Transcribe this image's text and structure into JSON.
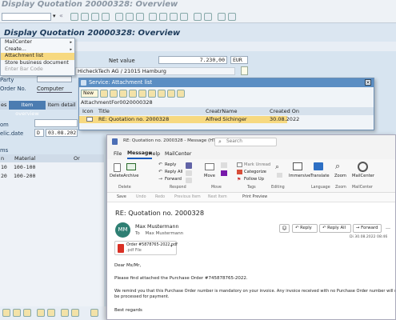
{
  "sap": {
    "title_bar": "Display Quotation 20000328: Overview",
    "screen_title": "Display Quotation 20000328: Overview",
    "menu": [
      "MailCenter",
      "Create...",
      "Attachment list",
      "Store business document",
      "Enter Bar Code"
    ],
    "net_value_label": "Net value",
    "net_value": "7.230,00",
    "currency": "EUR",
    "partner": "HicheckTech AG / 21015 Hamburg",
    "left_labels": {
      "party": "Party",
      "order_no": "Order No.",
      "computer": "Computer",
      "tab_overview": "Item overview",
      "tab_detail": "Item detail",
      "tab_sales": "es",
      "from": "om",
      "deliv_date": "elic.date",
      "items": "ms"
    },
    "deliv_date_type": "D",
    "deliv_date_value": "03.08.202",
    "item_table_headers": [
      "n",
      "Material",
      "Or"
    ],
    "item_rows": [
      {
        "num": "10",
        "material": "100-100"
      },
      {
        "num": "20",
        "material": "100-200"
      }
    ]
  },
  "attachment": {
    "title": "Service: Attachment list",
    "new_label": "New",
    "subtitle": "AttachmentFor0020000328",
    "headers": [
      "Icon",
      "Title",
      "CreatrName",
      "Created On"
    ],
    "row": {
      "title": "RE: Quotation no. 2000328",
      "creator": "Alfred Sichinger",
      "date": "30.08.2022"
    }
  },
  "outlook": {
    "title": "RE: Quotation no. 2000328 - Message (HTML)",
    "search_placeholder": "Search",
    "tabs": [
      "File",
      "Message",
      "Help",
      "MailCenter"
    ],
    "ribbon": {
      "delete": "Delete",
      "archive": "Archive",
      "delete_group": "Delete",
      "reply": "Reply",
      "reply_all": "Reply All",
      "forward": "Forward",
      "respond_group": "Respond",
      "move": "Move",
      "move_group": "Move",
      "mark_unread": "Mark Unread",
      "categorize": "Categorize",
      "follow_up": "Follow Up",
      "tags_group": "Tags",
      "editing_group": "Editing",
      "immersive": "Immersive",
      "translate": "Translate",
      "language_group": "Language",
      "zoom": "Zoom",
      "zoom_group": "Zoom",
      "mailcenter": "MailCenter",
      "mailcenter_group": "MailCenter"
    },
    "qat": [
      "Save",
      "Undo",
      "Redo",
      "Previous Item",
      "Next Item",
      "Print Preview"
    ],
    "subject": "RE: Quotation no. 2000328",
    "avatar_initials": "MM",
    "sender": "Max Mustermann",
    "to_label": "To",
    "to": "Max Mustermann",
    "actions": {
      "reply": "Reply",
      "reply_all": "Reply All",
      "forward": "Forward"
    },
    "date": "Di 30.08.2022 08:46",
    "attachment_name": "Order #5878765-2022.pdf",
    "attachment_type": ".pdf File",
    "body": {
      "greeting": "Dear Ms/Mr,",
      "p1": "Please find attached the Purchase Order #745878765-2022.",
      "p2a": "We remind you that this Purchase Order number is mandatory on your invoice. Any invoice received with no Purchase Order number will not",
      "p2b": "be processed for payment.",
      "closing": "Best regards"
    }
  }
}
